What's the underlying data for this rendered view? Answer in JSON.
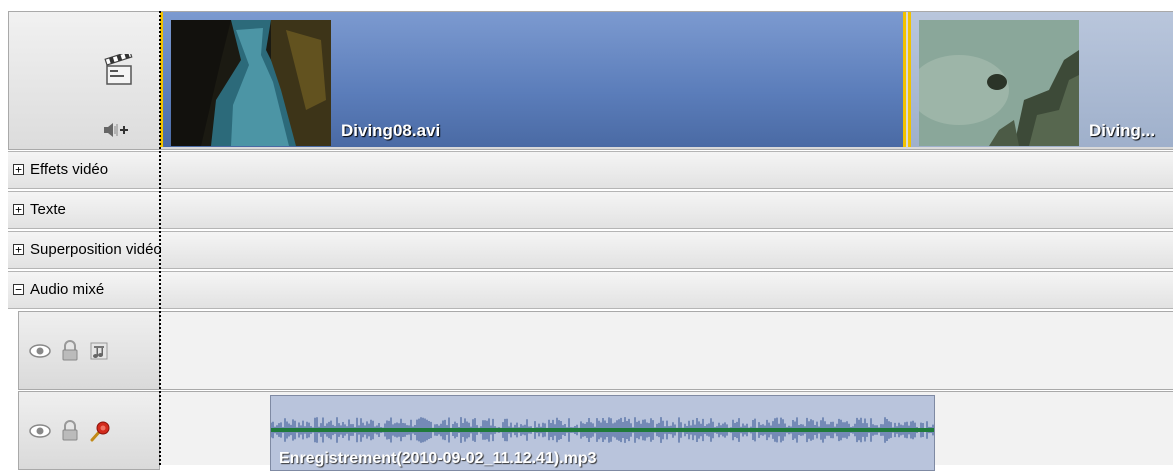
{
  "video_track": {
    "icons": [
      "clapperboard-icon",
      "speaker-add-icon"
    ],
    "clips": [
      {
        "name": "Diving08.avi"
      },
      {
        "name": "Diving..."
      }
    ]
  },
  "sections": [
    {
      "toggle": "+",
      "label": "Effets vidéo"
    },
    {
      "toggle": "+",
      "label": "Texte"
    },
    {
      "toggle": "+",
      "label": "Superposition vidéo"
    },
    {
      "toggle": "−",
      "label": "Audio mixé"
    }
  ],
  "audio_tracks": [
    {
      "icons": [
        "eye-icon",
        "lock-icon",
        "music-note-icon"
      ],
      "clip": null
    },
    {
      "icons": [
        "eye-icon",
        "lock-icon",
        "microphone-icon"
      ],
      "clip": {
        "name": "Enregistrement(2010-09-02_11.12.41).mp3"
      }
    }
  ],
  "colors": {
    "clip_border": "#f2c200",
    "video_clip": "#5b7dba",
    "audio_clip": "#b9c4dc",
    "waveform": "#2f4f8f",
    "waveform_center": "#1f7a3a"
  }
}
